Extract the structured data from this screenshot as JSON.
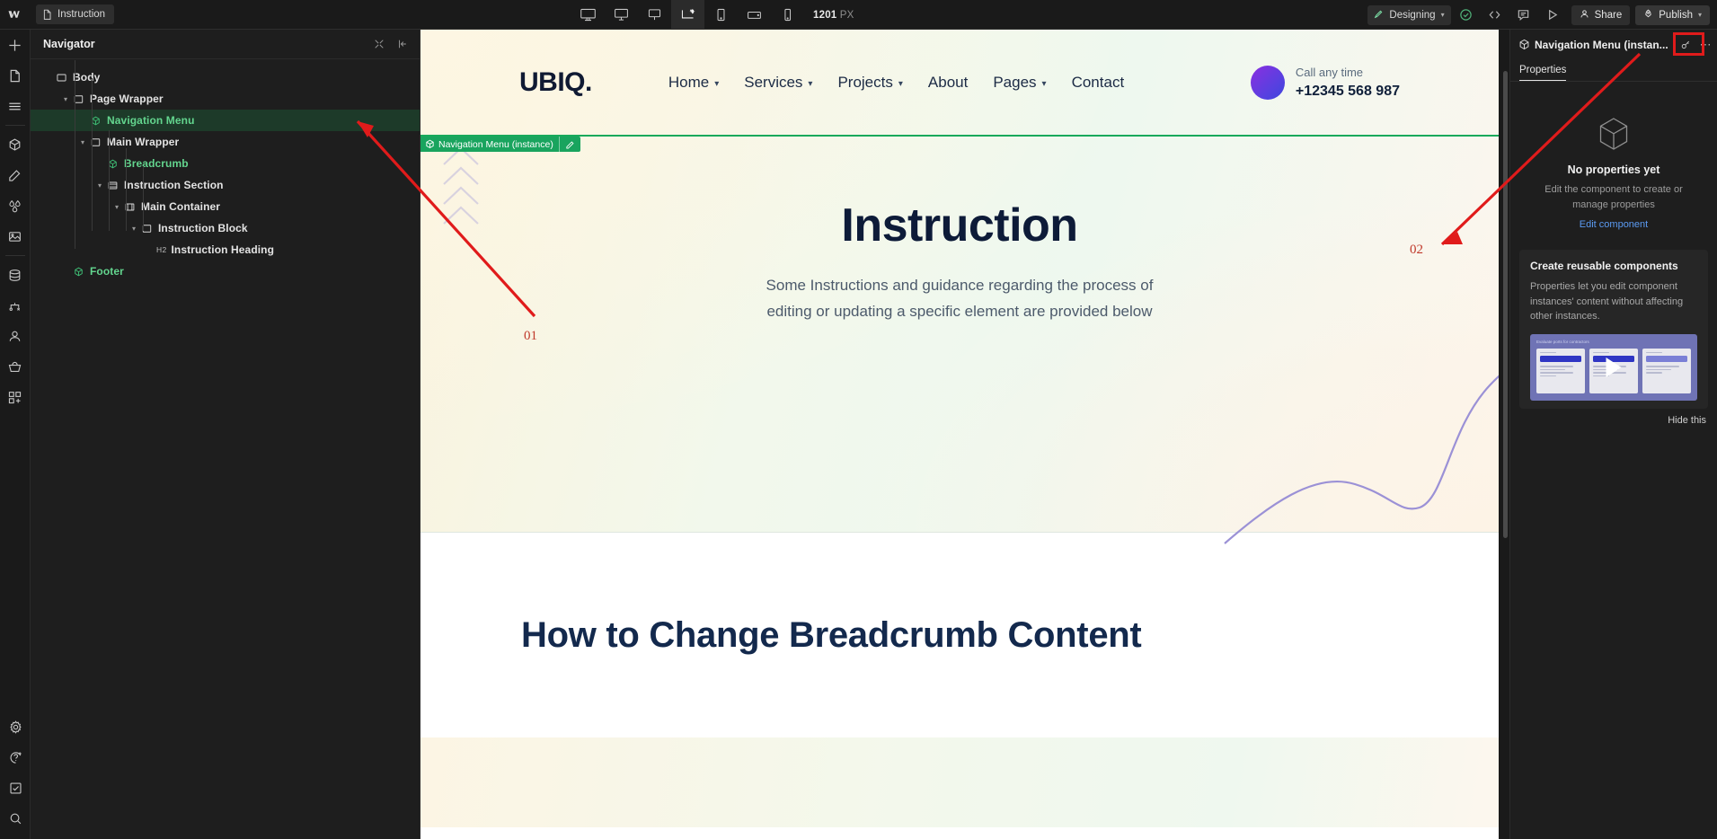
{
  "app": {
    "name": "Webflow Designer"
  },
  "topbar": {
    "page_tab": "Instruction",
    "breakpoints": [
      {
        "name": "desktop-large-breakpoint",
        "active": false
      },
      {
        "name": "desktop-breakpoint",
        "active": false
      },
      {
        "name": "desktop-small-breakpoint",
        "active": false
      },
      {
        "name": "base-breakpoint",
        "active": true
      },
      {
        "name": "tablet-breakpoint",
        "active": false
      },
      {
        "name": "mobile-landscape-breakpoint",
        "active": false
      },
      {
        "name": "mobile-portrait-breakpoint",
        "active": false
      }
    ],
    "viewport_size": "1201",
    "viewport_unit": "PX",
    "mode_label": "Designing",
    "share_label": "Share",
    "publish_label": "Publish",
    "icons": [
      "audit-check-icon",
      "code-icon",
      "comment-icon",
      "preview-play-icon"
    ]
  },
  "left_toolbar": {
    "items": [
      "add-element-icon",
      "pages-icon",
      "navigator-icon",
      "components-icon",
      "style-selector-icon",
      "variables-icon",
      "assets-icon",
      "cms-icon",
      "logic-icon",
      "users-icon",
      "ecommerce-icon",
      "apps-icon"
    ],
    "bottom_items": [
      "settings-gear-icon",
      "help-icon",
      "audit-checkbox-icon",
      "search-icon"
    ]
  },
  "navigator": {
    "title": "Navigator",
    "actions": [
      "collapse-all-icon",
      "close-panel-icon"
    ],
    "tree": [
      {
        "label": "Body",
        "depth": 0,
        "caret": false,
        "icon": "body-icon",
        "type": "element",
        "selected": false
      },
      {
        "label": "Page Wrapper",
        "depth": 1,
        "caret": true,
        "icon": "div-icon",
        "type": "element",
        "selected": false
      },
      {
        "label": "Navigation Menu",
        "depth": 2,
        "caret": false,
        "icon": "component-icon",
        "type": "component",
        "selected": true
      },
      {
        "label": "Main Wrapper",
        "depth": 2,
        "caret": true,
        "icon": "div-icon",
        "type": "element",
        "selected": false
      },
      {
        "label": "Breadcrumb",
        "depth": 3,
        "caret": false,
        "icon": "component-icon",
        "type": "component",
        "selected": false
      },
      {
        "label": "Instruction Section",
        "depth": 3,
        "caret": true,
        "icon": "section-icon",
        "type": "element",
        "selected": false
      },
      {
        "label": "Main Container",
        "depth": 4,
        "caret": true,
        "icon": "container-icon",
        "type": "element",
        "selected": false
      },
      {
        "label": "Instruction Block",
        "depth": 5,
        "caret": true,
        "icon": "div-icon",
        "type": "element",
        "selected": false
      },
      {
        "label": "Instruction Heading",
        "depth": 6,
        "caret": false,
        "icon": "heading-icon",
        "type": "heading",
        "tag": "H2",
        "selected": false
      },
      {
        "label": "Footer",
        "depth": 1,
        "caret": false,
        "icon": "component-icon",
        "type": "component",
        "selected": false
      }
    ]
  },
  "canvas": {
    "badge": {
      "label": "Navigation Menu (instance)",
      "edit_icon": "pencil-icon"
    },
    "site": {
      "brand": "UBIQ.",
      "menu": [
        {
          "label": "Home",
          "has_dropdown": true
        },
        {
          "label": "Services",
          "has_dropdown": true
        },
        {
          "label": "Projects",
          "has_dropdown": true
        },
        {
          "label": "About",
          "has_dropdown": false
        },
        {
          "label": "Pages",
          "has_dropdown": true
        },
        {
          "label": "Contact",
          "has_dropdown": false
        }
      ],
      "call": {
        "label": "Call any time",
        "phone": "+12345 568 987"
      },
      "hero_title": "Instruction",
      "hero_paragraph_line1": "Some Instructions and guidance regarding the process of",
      "hero_paragraph_line2": "editing or updating a specific element are provided below",
      "section_heading": "How to Change Breadcrumb Content"
    }
  },
  "right_panel": {
    "title": "Navigation Menu (instan...",
    "component_icon": "component-icon",
    "header_actions": [
      "edit-component-icon",
      "more-options-icon"
    ],
    "tab": "Properties",
    "empty": {
      "icon": "component-cube-icon",
      "title": "No properties yet",
      "subtitle": "Edit the component to create or manage properties",
      "link": "Edit component"
    },
    "promo": {
      "title": "Create reusable components",
      "body": "Properties let you edit component instances' content without affecting other instances.",
      "video_caption": "Evaluate ports for contractors",
      "play_icon": "play-icon",
      "hide_label": "Hide this"
    }
  },
  "annotations": [
    {
      "label": "01",
      "name": "annotation-01"
    },
    {
      "label": "02",
      "name": "annotation-02"
    }
  ],
  "colors": {
    "accent_green": "#19a45e",
    "annotation_red": "#e01b1b",
    "link_blue": "#5b9bf3",
    "panel_bg": "#1e1e1e"
  }
}
